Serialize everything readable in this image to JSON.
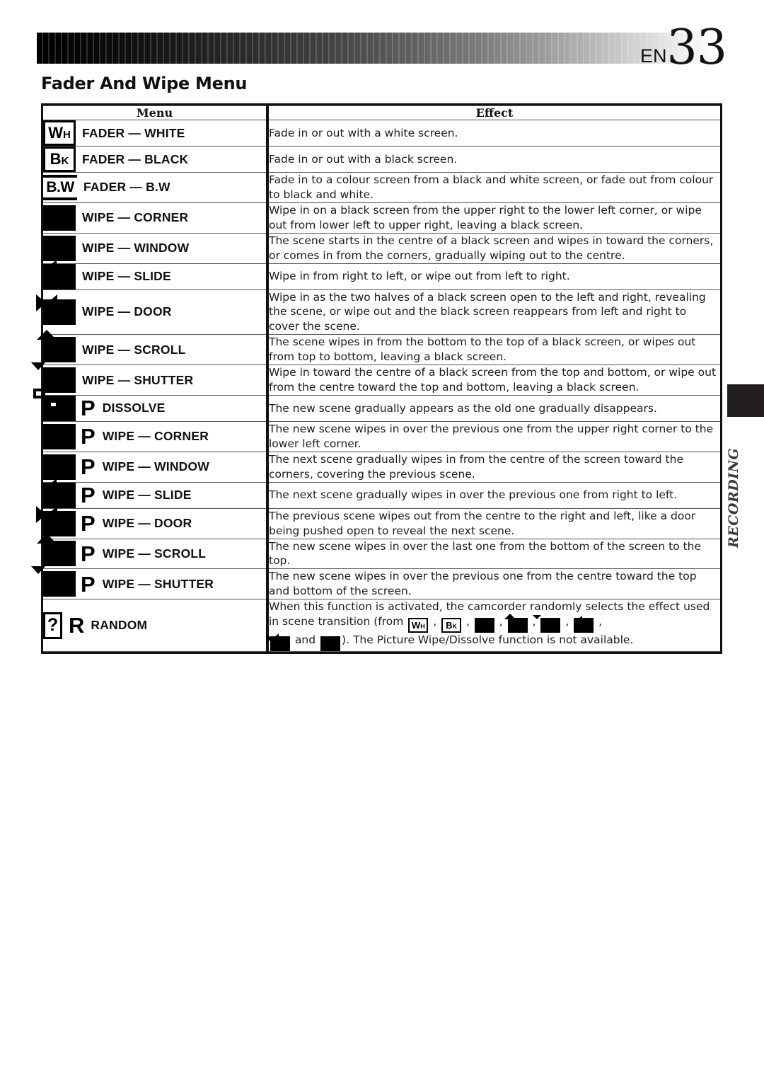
{
  "page": {
    "locale_code": "EN",
    "page_number": "33",
    "section_title": "Fader And Wipe Menu",
    "side_tab_label": "RECORDING"
  },
  "table": {
    "headers": {
      "menu": "Menu",
      "effect": "Effect"
    },
    "rows": [
      {
        "icon": "fader-white-icon",
        "icon_code_big": "W",
        "icon_code_small": "H",
        "label": "FADER — WHITE",
        "effect": "Fade in or out with a white screen."
      },
      {
        "icon": "fader-black-icon",
        "icon_code_big": "B",
        "icon_code_small": "K",
        "label": "FADER — BLACK",
        "effect": "Fade in or out with a black screen."
      },
      {
        "icon": "fader-bw-icon",
        "icon_code_big": "B.W",
        "icon_code_small": "",
        "label": "FADER — B.W",
        "effect": "Fade in to a colour screen from a black and white screen, or fade out from colour to black and white."
      },
      {
        "icon": "wipe-corner-icon",
        "label": "WIPE — CORNER",
        "effect": "Wipe in on a black screen from the upper right to the lower left corner, or wipe out from lower left to upper right, leaving a black screen."
      },
      {
        "icon": "wipe-window-icon",
        "label": "WIPE — WINDOW",
        "effect": "The scene starts in the centre of a black screen and wipes in toward the corners, or comes in from the corners, gradually wiping out to the centre."
      },
      {
        "icon": "wipe-slide-icon",
        "label": "WIPE — SLIDE",
        "effect": "Wipe in from right to left, or wipe out from left to right."
      },
      {
        "icon": "wipe-door-icon",
        "label": "WIPE — DOOR",
        "effect": "Wipe in as the two halves of a black screen open to the left and right, revealing the scene, or wipe out and the black screen reappears from left and right to cover the scene."
      },
      {
        "icon": "wipe-scroll-icon",
        "label": "WIPE — SCROLL",
        "effect": "The scene wipes in from the bottom to the top of a black screen, or wipes out from top to bottom, leaving a black screen."
      },
      {
        "icon": "wipe-shutter-icon",
        "label": "WIPE — SHUTTER",
        "effect": "Wipe in toward the centre of a black screen from the top and bottom, or wipe out from the centre toward the top and bottom, leaving a black screen."
      },
      {
        "icon": "dissolve-icon",
        "suffix": "P",
        "label": "DISSOLVE",
        "effect": "The new scene gradually appears as the old one gradually disappears."
      },
      {
        "icon": "picture-wipe-corner-icon",
        "suffix": "P",
        "label": "WIPE — CORNER",
        "effect": "The new scene wipes in over the previous one from the upper right corner to the lower left corner."
      },
      {
        "icon": "picture-wipe-window-icon",
        "suffix": "P",
        "label": "WIPE — WINDOW",
        "effect": "The next scene gradually wipes in from the centre of the screen toward the corners, covering the previous scene."
      },
      {
        "icon": "picture-wipe-slide-icon",
        "suffix": "P",
        "label": "WIPE — SLIDE",
        "effect": "The next scene gradually wipes in over the previous one from right to left."
      },
      {
        "icon": "picture-wipe-door-icon",
        "suffix": "P",
        "label": "WIPE — DOOR",
        "effect": "The previous scene wipes out from the centre to the right and left, like a door being pushed open to reveal the next scene."
      },
      {
        "icon": "picture-wipe-scroll-icon",
        "suffix": "P",
        "label": "WIPE — SCROLL",
        "effect": "The new scene wipes in over the last one from the bottom of the screen to the top."
      },
      {
        "icon": "picture-wipe-shutter-icon",
        "suffix": "P",
        "label": "WIPE — SHUTTER",
        "effect": "The new scene wipes in over the previous one from the centre toward the top and bottom of the screen."
      },
      {
        "icon": "random-icon",
        "suffix": "R",
        "icon_code_big": "?",
        "label": "RANDOM",
        "effect": ""
      }
    ],
    "random_effect": {
      "part1": "When this function is activated, the camcorder randomly selects the effect used in scene transition (from",
      "sep": ",",
      "conj": "and",
      "part2": "). The Picture Wipe/Dissolve function is not available."
    }
  }
}
